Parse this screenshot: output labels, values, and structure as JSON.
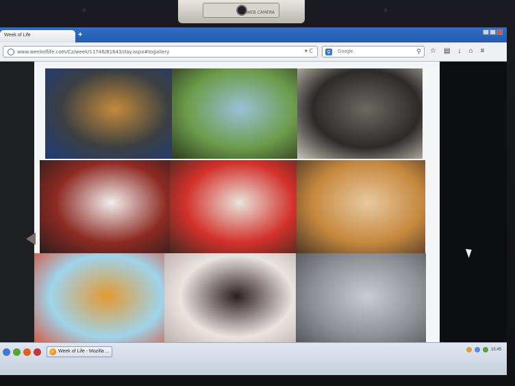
{
  "browser": {
    "tab_title": "Week of Life",
    "new_tab_symbol": "+",
    "url": "www.weekoflife.com/Cz/week/11746/81643/day.aspx#togallery",
    "search_engine_icon": "google-g",
    "search_placeholder": "Google",
    "toolbar_icons": [
      "star-icon",
      "library-icon",
      "download-icon",
      "home-icon",
      "menu-icon"
    ]
  },
  "webcam": {
    "brand": "WEB CAMERA"
  },
  "gallery": {
    "prev_button": "previous-arrow",
    "photos": [
      {
        "subject": "cosmetics-table",
        "colors": [
          "#3a3f42",
          "#c58a3a",
          "#1f3a7a"
        ]
      },
      {
        "subject": "park-avenue-castle",
        "colors": [
          "#6d9c4b",
          "#9bc0d8",
          "#2d3b1e"
        ]
      },
      {
        "subject": "silhouette-person",
        "colors": [
          "#2c2b2a",
          "#6a6962",
          "#c9c4b6"
        ]
      },
      {
        "subject": "woman-heart-shirt",
        "colors": [
          "#8d2a22",
          "#f2eeee",
          "#2a1d1c"
        ]
      },
      {
        "subject": "man-red-shirt",
        "colors": [
          "#d3302a",
          "#e8e4dc",
          "#3d2a20"
        ]
      },
      {
        "subject": "glasses-table",
        "colors": [
          "#c6883e",
          "#e8c9a0",
          "#4a3426"
        ]
      },
      {
        "subject": "gingerbread-hearts",
        "colors": [
          "#9fd4ea",
          "#e39a34",
          "#d94a30"
        ]
      },
      {
        "subject": "woman-with-cat",
        "colors": [
          "#e9e4e0",
          "#2a2023",
          "#b7a8a8"
        ]
      },
      {
        "subject": "grey-cat",
        "colors": [
          "#8c8f94",
          "#c9ccd0",
          "#4d5054"
        ]
      }
    ]
  },
  "taskbar": {
    "window_button": "Week of Life - Mozilla ...",
    "clock": "15:45"
  }
}
